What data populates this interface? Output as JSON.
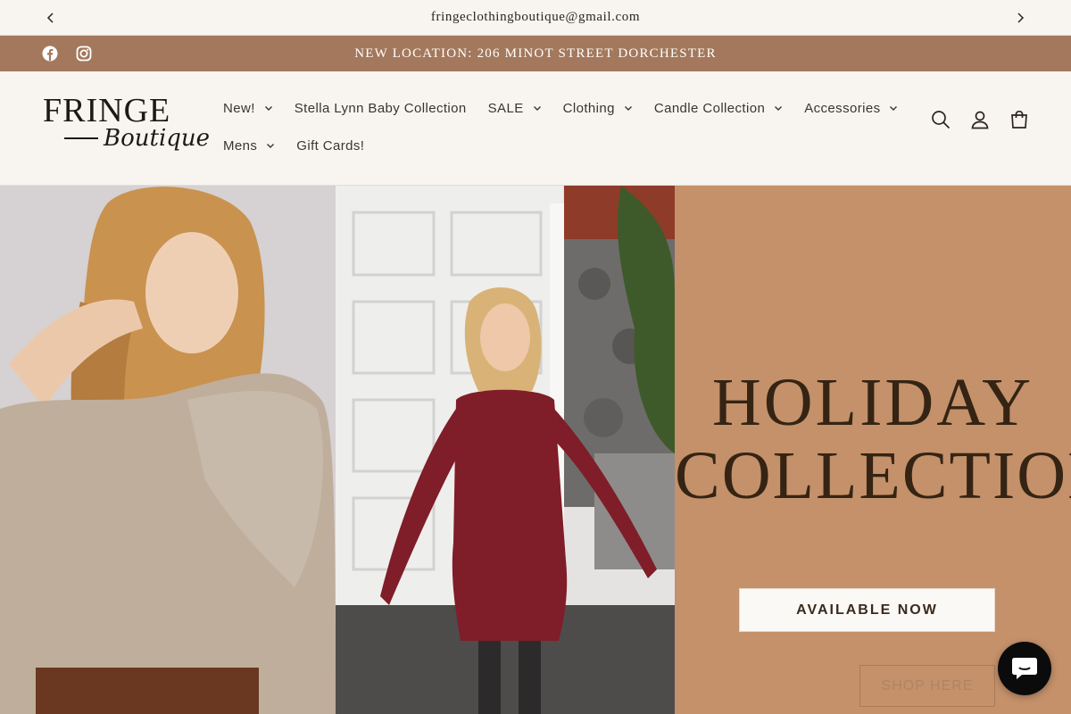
{
  "announcement": {
    "email": "fringeclothingboutique@gmail.com"
  },
  "location_bar": {
    "text": "NEW LOCATION: 206 MINOT STREET DORCHESTER",
    "bg": "#a3785c"
  },
  "logo": {
    "line1": "FRINGE",
    "line2": "Boutique"
  },
  "nav": {
    "row1": [
      {
        "label": "New!",
        "dropdown": true
      },
      {
        "label": "Stella Lynn Baby Collection",
        "dropdown": false
      },
      {
        "label": "SALE",
        "dropdown": true
      },
      {
        "label": "Clothing",
        "dropdown": true
      },
      {
        "label": "Candle Collection",
        "dropdown": true
      },
      {
        "label": "Accessories",
        "dropdown": true
      }
    ],
    "row2": [
      {
        "label": "Mens",
        "dropdown": true
      },
      {
        "label": "Gift Cards!",
        "dropdown": false
      }
    ]
  },
  "header_icons": [
    "search-icon",
    "account-icon",
    "cart-icon"
  ],
  "hero": {
    "title_line1": "HOLIDAY",
    "title_line2": "COLLECTION",
    "badge": "AVAILABLE NOW",
    "cta": "SHOP HERE",
    "panel_color": "#c4916a"
  }
}
